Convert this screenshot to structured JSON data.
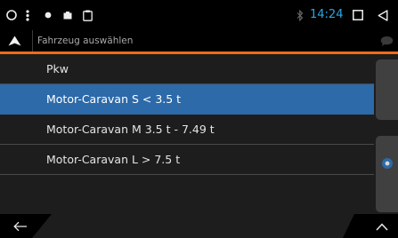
{
  "status_bar": {
    "time": "14:24",
    "accent_color": "#29a8e6",
    "icons": [
      "circle-icon",
      "more-vert-icon",
      "dot-icon",
      "battery-icon",
      "clipboard-icon",
      "bluetooth-icon",
      "recent-apps-icon",
      "back-nav-icon"
    ]
  },
  "header": {
    "title": "Fahrzeug auswählen",
    "icons": [
      "navigation-arrow-icon",
      "chat-bubble-icon"
    ],
    "accent_line_color": "#f26a1b"
  },
  "vehicle_list": {
    "items": [
      {
        "label": "Pkw",
        "selected": false
      },
      {
        "label": "Motor-Caravan S < 3.5 t",
        "selected": true
      },
      {
        "label": "Motor-Caravan M 3.5 t - 7.49 t",
        "selected": false
      },
      {
        "label": "Motor-Caravan L > 7.5 t",
        "selected": false
      }
    ],
    "selection_color": "#2c6aa9"
  },
  "bottom_bar": {
    "icons": [
      "arrow-left-icon",
      "chevron-up-icon"
    ]
  }
}
